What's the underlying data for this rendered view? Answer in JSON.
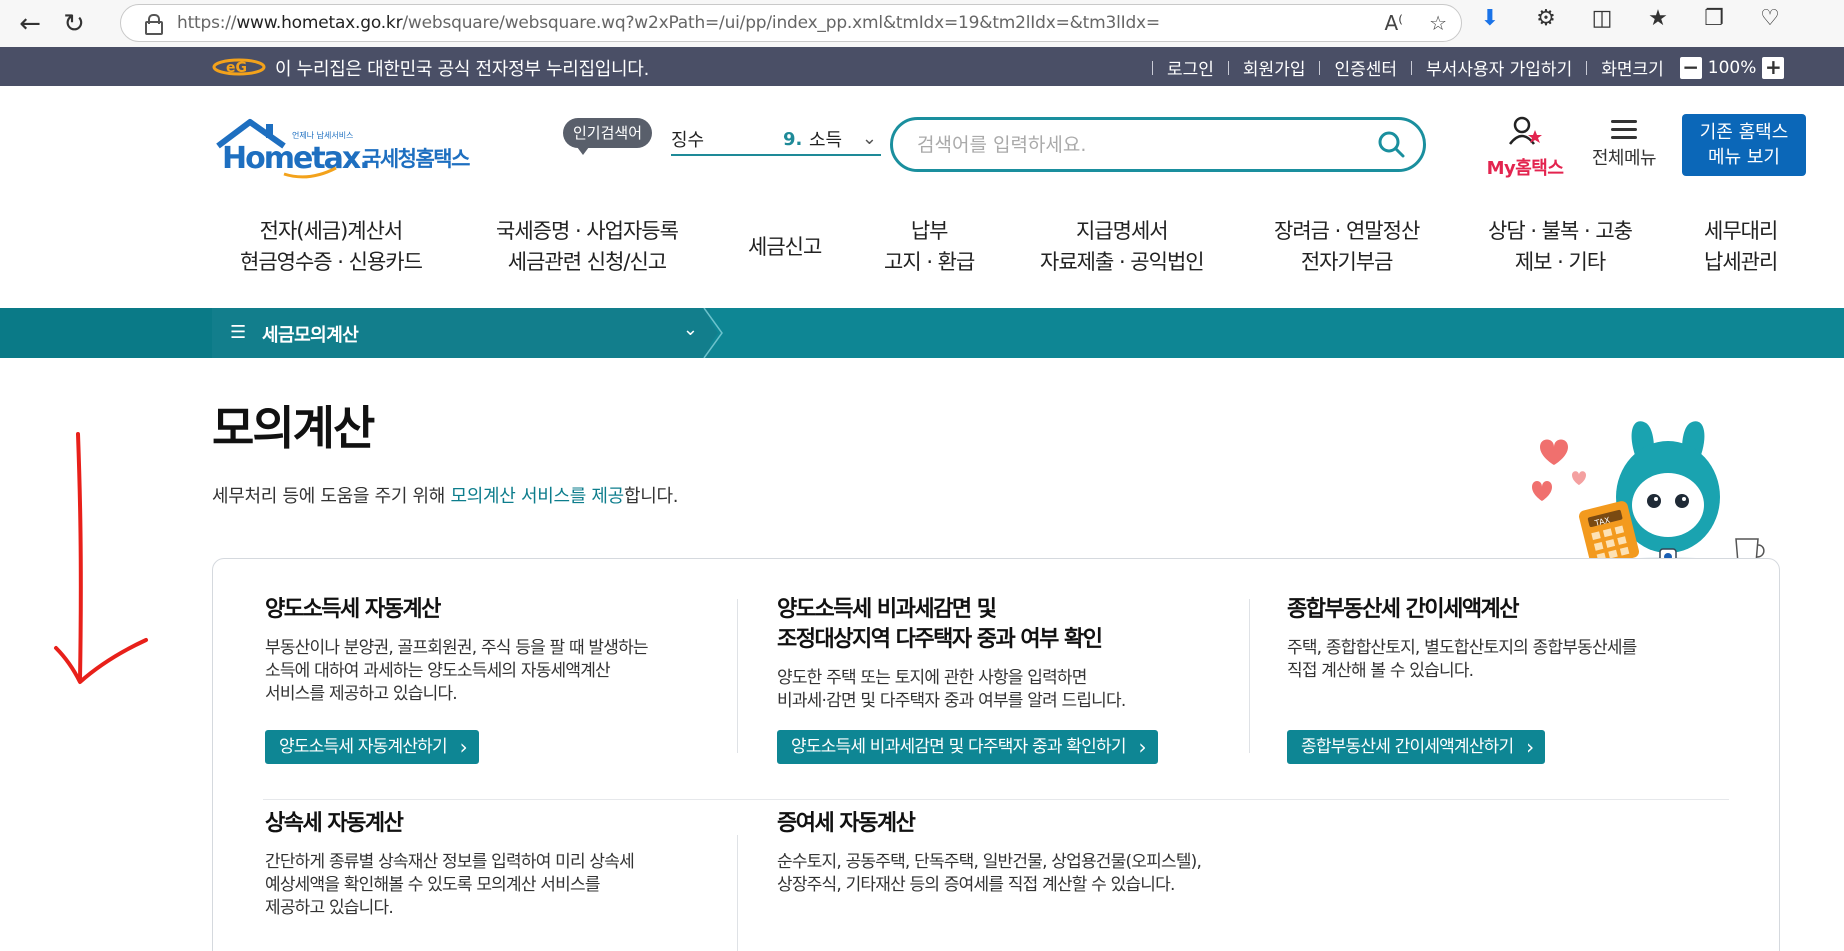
{
  "browser": {
    "url_prefix": "https://",
    "url_domain": "www.hometax.go.kr",
    "url_path": "/websquare/websquare.wq?w2xPath=/ui/pp/index_pp.xml&tmIdx=19&tm2lIdx=&tm3lIdx="
  },
  "gov_bar": {
    "notice": "이 누리집은 대한민국 공식 전자정부 누리집입니다.",
    "links": [
      "로그인",
      "회원가입",
      "인증센터",
      "부서사용자 가입하기"
    ],
    "zoom_label": "화면크기",
    "zoom_minus": "−",
    "zoom_value": "100%",
    "zoom_plus": "+"
  },
  "header": {
    "logo_small": "언제나 납세서비스",
    "logo_main": "Hometax.",
    "logo_kr": "국세청홈택스",
    "hot_badge": "인기검색어",
    "hot_term_label": "징수",
    "hot_term_rank": "9.",
    "hot_term_word": "소득",
    "search_placeholder": "검색어를 입력하세요.",
    "my_hometax": "My홈택스",
    "all_menu": "전체메뉴",
    "old_menu_line1": "기존 홈택스",
    "old_menu_line2": "메뉴 보기"
  },
  "gnb": [
    {
      "l1": "전자(세금)계산서",
      "l2": "현금영수증 · 신용카드"
    },
    {
      "l1": "국세증명 · 사업자등록",
      "l2": "세금관련 신청/신고"
    },
    {
      "l1": "세금신고",
      "l2": ""
    },
    {
      "l1": "납부",
      "l2": "고지 · 환급"
    },
    {
      "l1": "지급명세서",
      "l2": "자료제출 · 공익법인"
    },
    {
      "l1": "장려금 · 연말정산",
      "l2": "전자기부금"
    },
    {
      "l1": "상담 · 불복 · 고충",
      "l2": "제보 · 기타"
    },
    {
      "l1": "세무대리",
      "l2": "납세관리"
    }
  ],
  "sub_bar": {
    "menu": "세금모의계산"
  },
  "main": {
    "title": "모의계산",
    "desc_before": "세무처리 등에 도움을 주기 위해 ",
    "desc_highlight": "모의계산 서비스를 제공",
    "desc_after": "합니다.",
    "mascot_tag": "TAX"
  },
  "cards": [
    {
      "title1": "양도소득세 자동계산",
      "title2": "",
      "desc": [
        "부동산이나 분양권, 골프회원권, 주식 등을 팔 때 발생하는",
        "소득에 대하여 과세하는 양도소득세의 자동세액계산",
        "서비스를 제공하고 있습니다."
      ],
      "button": "양도소득세 자동계산하기"
    },
    {
      "title1": "양도소득세 비과세감면 및",
      "title2": "조정대상지역 다주택자 중과 여부 확인",
      "desc": [
        "양도한 주택 또는 토지에 관한 사항을 입력하면",
        "비과세·감면 및 다주택자 중과 여부를 알려 드립니다.",
        ""
      ],
      "button": "양도소득세 비과세감면 및 다주택자 중과 확인하기"
    },
    {
      "title1": "종합부동산세 간이세액계산",
      "title2": "",
      "desc": [
        "주택, 종합합산토지, 별도합산토지의 종합부동산세를",
        "직접 계산해 볼 수 있습니다.",
        ""
      ],
      "button": "종합부동산세 간이세액계산하기"
    },
    {
      "title1": "상속세 자동계산",
      "title2": "",
      "desc": [
        "간단하게 종류별 상속재산 정보를 입력하여 미리 상속세",
        "예상세액을 확인해볼 수 있도록 모의계산 서비스를",
        "제공하고 있습니다."
      ],
      "button": ""
    },
    {
      "title1": "증여세 자동계산",
      "title2": "",
      "desc": [
        "순수토지, 공동주택, 단독주택, 일반건물, 상업용건물(오피스텔),",
        "상장주식, 기타재산 등의 증여세를 직접 계산할 수 있습니다.",
        ""
      ],
      "button": ""
    }
  ],
  "colors": {
    "teal": "#0e8694",
    "gov_bar": "#4a4f66",
    "old_menu": "#0b67b8",
    "my_red": "#e3244f",
    "annotation_red": "#e8201a"
  }
}
